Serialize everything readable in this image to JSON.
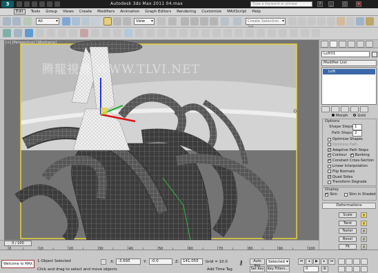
{
  "titlebar": {
    "logo": "3",
    "title": "Autodesk 3ds Max  2011     04.max",
    "search_placeholder": "Type a keyword or phrase",
    "buttons": [
      "?",
      "_",
      "□",
      "×"
    ]
  },
  "menu": [
    "Edit",
    "Tools",
    "Group",
    "Views",
    "Create",
    "Modifiers",
    "Animation",
    "Graph Editors",
    "Rendering",
    "Customize",
    "MAXScript",
    "Help"
  ],
  "toolbar": {
    "selection_filter": "All",
    "reference_coord": "View",
    "named_selection": "Create Selection Set"
  },
  "viewport": {
    "label": "[+] [Perspective] [Wireframe]",
    "watermark": "腾龍視覺 WWW.TLVI.NET"
  },
  "command_panel": {
    "object_name": "Loft01",
    "modifier_list": "Modifier List",
    "stack_item": "Loft",
    "morph_grid": [
      "Morph",
      "Grid"
    ],
    "options_title": "Options",
    "shape_steps_label": "Shape Steps:",
    "shape_steps": "1",
    "path_steps_label": "Path Steps:",
    "path_steps": "2",
    "options": [
      {
        "label": "Optimize Shapes",
        "checked": false,
        "disabled": false
      },
      {
        "label": "Optimize Path",
        "checked": false,
        "disabled": true
      },
      {
        "label": "Adaptive Path Steps",
        "checked": true,
        "disabled": false
      },
      {
        "label": "Contour",
        "checked": true,
        "disabled": false,
        "extra": "Banking"
      },
      {
        "label": "Constant Cross-Section",
        "checked": true,
        "disabled": false
      },
      {
        "label": "Linear Interpolation",
        "checked": false,
        "disabled": false
      },
      {
        "label": "Flip Normals",
        "checked": false,
        "disabled": false
      },
      {
        "label": "Quad Sides",
        "checked": true,
        "disabled": false
      },
      {
        "label": "Transform Degrade",
        "checked": false,
        "disabled": false
      }
    ],
    "display_title": "Display",
    "skin_label": "Skin",
    "skin_shaded_label": "Skin in Shaded",
    "deformations_title": "Deformations",
    "deformations": [
      {
        "label": "Scale",
        "on": true
      },
      {
        "label": "Twist",
        "on": true
      },
      {
        "label": "Teeter",
        "on": false
      },
      {
        "label": "Bevel",
        "on": false
      },
      {
        "label": "Fit",
        "on": false
      }
    ]
  },
  "timeline": {
    "slider": "0 / 100",
    "ticks": [
      "0",
      "10",
      "20",
      "30",
      "40",
      "50",
      "60",
      "70",
      "80",
      "90",
      "100"
    ]
  },
  "status": {
    "maxscript": "Welcome to MAX",
    "selected": "1 Object Selected",
    "prompt": "Click and drag to select and move objects",
    "x_label": "X:",
    "x": "-3.695",
    "y_label": "Y:",
    "y": "-0.0",
    "z_label": "Z:",
    "z": "141.055",
    "grid": "Grid = 10.0",
    "add_time_tag": "Add Time Tag",
    "auto_key": "Auto Key",
    "set_key": "Set Key",
    "key_mode": "Selected",
    "key_filters": "Key Filters...",
    "frame": "0"
  }
}
